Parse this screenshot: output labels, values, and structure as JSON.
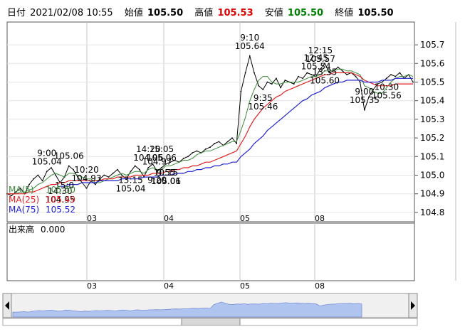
{
  "header": {
    "date_label": "日付",
    "date": "2021/02/08 10:55",
    "open_label": "始値",
    "open": "105.50",
    "high_label": "高値",
    "high": "105.53",
    "low_label": "安値",
    "low": "105.50",
    "close_label": "終値",
    "close": "105.50"
  },
  "legend": [
    {
      "label": "MA(5)",
      "value": "105.50",
      "color": "#3a8a3a"
    },
    {
      "label": "MA(25)",
      "value": "105.49",
      "color": "#e02020"
    },
    {
      "label": "MA(75)",
      "value": "105.52",
      "color": "#2020d0"
    }
  ],
  "volume_panel": {
    "label": "出来高",
    "value": "0.000"
  },
  "colors": {
    "price": "#000000",
    "ma5": "#3a8a3a",
    "ma25": "#e02020",
    "ma75": "#2020d0",
    "scroll_fill": "#b0c4f0"
  },
  "chart_data": {
    "type": "line",
    "ylim": [
      104.75,
      105.75
    ],
    "y_ticks": [
      "105.7",
      "105.6",
      "105.5",
      "105.4",
      "105.3",
      "105.2",
      "105.1",
      "105.0",
      "104.9",
      "104.8"
    ],
    "x_ticks": [
      "03",
      "04",
      "05",
      "08"
    ],
    "series": [
      {
        "name": "price",
        "values": [
          104.9,
          104.89,
          104.91,
          104.93,
          104.9,
          104.95,
          104.98,
          105.0,
          104.97,
          105.02,
          105.04,
          105.0,
          104.96,
          104.99,
          105.05,
          105.03,
          104.99,
          104.96,
          104.93,
          104.97,
          104.95,
          104.98,
          105.0,
          104.99,
          105.01,
          105.03,
          105.0,
          104.98,
          105.02,
          105.05,
          105.03,
          104.99,
          105.04,
          105.06,
          105.02,
          105.04,
          105.06,
          105.07,
          105.08,
          105.07,
          105.09,
          105.1,
          105.12,
          105.13,
          105.12,
          105.14,
          105.15,
          105.17,
          105.18,
          105.16,
          105.18,
          105.2,
          105.17,
          105.45,
          105.55,
          105.64,
          105.55,
          105.48,
          105.46,
          105.5,
          105.49,
          105.52,
          105.47,
          105.51,
          105.5,
          105.49,
          105.53,
          105.52,
          105.55,
          105.54,
          105.53,
          105.57,
          105.6,
          105.55,
          105.56,
          105.58,
          105.56,
          105.54,
          105.55,
          105.53,
          105.5,
          105.35,
          105.42,
          105.46,
          105.49,
          105.5,
          105.52,
          105.54,
          105.53,
          105.55,
          105.52,
          105.54,
          105.5
        ]
      },
      {
        "name": "MA(5)",
        "values": [
          104.9,
          104.9,
          104.9,
          104.91,
          104.91,
          104.92,
          104.93,
          104.95,
          104.96,
          104.98,
          105.0,
          105.01,
          105.0,
          104.99,
          105.01,
          105.01,
          105.0,
          104.99,
          104.98,
          104.98,
          104.96,
          104.96,
          104.97,
          104.98,
          104.99,
          105.0,
          105.01,
          105.0,
          105.01,
          105.02,
          105.02,
          105.01,
          105.03,
          105.04,
          105.03,
          105.03,
          105.05,
          105.05,
          105.06,
          105.07,
          105.08,
          105.08,
          105.09,
          105.11,
          105.12,
          105.13,
          105.13,
          105.14,
          105.15,
          105.16,
          105.17,
          105.18,
          105.18,
          105.24,
          105.31,
          105.4,
          105.46,
          105.51,
          105.53,
          105.53,
          105.5,
          105.49,
          105.49,
          105.5,
          105.5,
          105.5,
          105.5,
          105.51,
          105.52,
          105.53,
          105.53,
          105.54,
          105.56,
          105.56,
          105.56,
          105.57,
          105.57,
          105.56,
          105.56,
          105.55,
          105.54,
          105.48,
          105.47,
          105.45,
          105.44,
          105.44,
          105.47,
          105.5,
          105.52,
          105.53,
          105.53,
          105.54,
          105.53
        ]
      },
      {
        "name": "MA(25)",
        "values": [
          104.9,
          104.9,
          104.9,
          104.9,
          104.9,
          104.91,
          104.91,
          104.92,
          104.93,
          104.94,
          104.95,
          104.95,
          104.96,
          104.96,
          104.97,
          104.97,
          104.97,
          104.97,
          104.97,
          104.97,
          104.97,
          104.97,
          104.98,
          104.98,
          104.98,
          104.99,
          104.99,
          104.99,
          104.99,
          105.0,
          105.0,
          105.0,
          105.0,
          105.01,
          105.01,
          105.01,
          105.02,
          105.02,
          105.03,
          105.03,
          105.04,
          105.04,
          105.05,
          105.05,
          105.06,
          105.07,
          105.07,
          105.08,
          105.09,
          105.1,
          105.11,
          105.12,
          105.13,
          105.17,
          105.21,
          105.26,
          105.3,
          105.33,
          105.36,
          105.38,
          105.4,
          105.42,
          105.43,
          105.45,
          105.46,
          105.47,
          105.48,
          105.49,
          105.5,
          105.51,
          105.52,
          105.53,
          105.54,
          105.54,
          105.55,
          105.55,
          105.55,
          105.55,
          105.55,
          105.54,
          105.53,
          105.51,
          105.5,
          105.49,
          105.48,
          105.48,
          105.48,
          105.48,
          105.49,
          105.49,
          105.49,
          105.49,
          105.49
        ]
      },
      {
        "name": "MA(75)",
        "values": [
          null,
          null,
          null,
          null,
          null,
          null,
          null,
          null,
          null,
          null,
          null,
          null,
          104.94,
          104.94,
          104.95,
          104.95,
          104.95,
          104.96,
          104.96,
          104.96,
          104.96,
          104.97,
          104.97,
          104.97,
          104.97,
          104.97,
          104.98,
          104.98,
          104.98,
          104.98,
          104.98,
          104.99,
          104.99,
          104.99,
          104.99,
          105.0,
          105.0,
          105.0,
          105.01,
          105.01,
          105.01,
          105.02,
          105.02,
          105.03,
          105.03,
          105.04,
          105.04,
          105.05,
          105.05,
          105.06,
          105.06,
          105.07,
          105.07,
          105.1,
          105.12,
          105.14,
          105.17,
          105.19,
          105.21,
          105.24,
          105.26,
          105.28,
          105.3,
          105.32,
          105.34,
          105.36,
          105.38,
          105.4,
          105.41,
          105.43,
          105.44,
          105.45,
          105.47,
          105.48,
          105.49,
          105.5,
          105.5,
          105.51,
          105.51,
          105.51,
          105.51,
          105.5,
          105.5,
          105.5,
          105.5,
          105.51,
          105.51,
          105.51,
          105.52,
          105.52,
          105.52,
          105.52,
          105.52
        ]
      }
    ],
    "annotations": [
      {
        "time": "9:00",
        "price": "105.04",
        "at": 9
      },
      {
        "time": "14:30",
        "price": "104.95",
        "at": 12
      },
      {
        "time": "",
        "price": "105.06",
        "at": 14
      },
      {
        "time": "15:0",
        "price": "",
        "at": 13
      },
      {
        "time": "10:20",
        "price": "104.93",
        "at": 18
      },
      {
        "time": "13:15",
        "price": "105.04",
        "at": 28
      },
      {
        "time": "15:05",
        "price": "105.06",
        "at": 35
      },
      {
        "time": "9:55",
        "price": "105.06",
        "at": 36
      },
      {
        "time": "14:20",
        "price": "104.96",
        "at": 32
      },
      {
        "time": "10:15",
        "price": "105.01",
        "at": 36
      },
      {
        "time": "",
        "price": "104.97",
        "at": 34
      },
      {
        "time": "9:20",
        "price": "",
        "at": 34
      },
      {
        "time": "9:10",
        "price": "105.64",
        "at": 55
      },
      {
        "time": "9:35",
        "price": "105.46",
        "at": 58
      },
      {
        "time": "12:15",
        "price": "105.57",
        "at": 71
      },
      {
        "time": "13:35",
        "price": "105.60",
        "at": 72
      },
      {
        "time": "12:45",
        "price": "105.54",
        "at": 70
      },
      {
        "time": "10:30",
        "price": "105.56",
        "at": 86
      },
      {
        "time": "9:00",
        "price": "105.35",
        "at": 81
      }
    ]
  }
}
